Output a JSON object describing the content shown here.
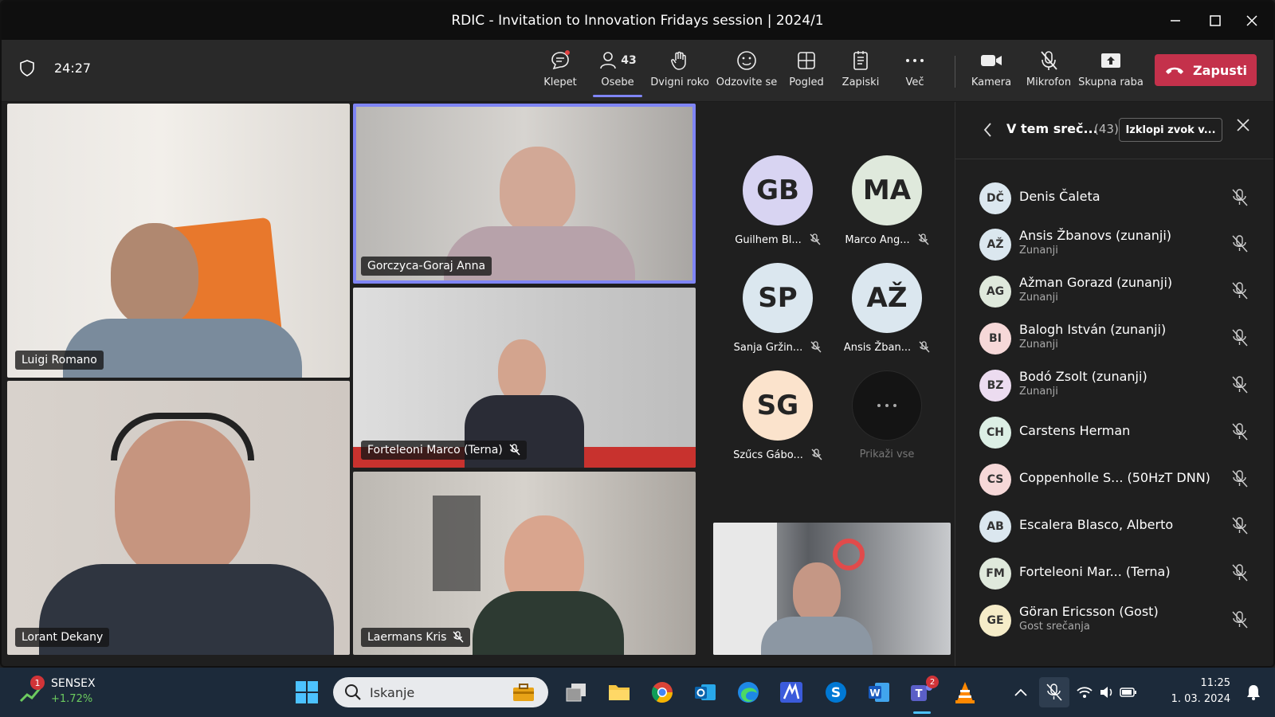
{
  "window": {
    "title": "RDIC - Invitation to Innovation Fridays session | 2024/1"
  },
  "toolbar": {
    "timer": "24:27",
    "chat_label": "Klepet",
    "people_label": "Osebe",
    "people_count": "43",
    "raise_label": "Dvigni roko",
    "react_label": "Odzovite se",
    "view_label": "Pogled",
    "notes_label": "Zapiski",
    "more_label": "Več",
    "camera_label": "Kamera",
    "mic_label": "Mikrofon",
    "share_label": "Skupna raba",
    "leave_label": "Zapusti"
  },
  "tiles": {
    "luigi": "Luigi Romano",
    "anna": "Gorczyca-Goraj Anna",
    "marco": "Forteleoni Marco (Terna)",
    "lorant": "Lorant Dekany",
    "kris": "Laermans Kris"
  },
  "avatars": [
    {
      "initials": "GB",
      "name": "Guilhem Bl...",
      "color": "#d8d4f2"
    },
    {
      "initials": "MA",
      "name": "Marco Ang...",
      "color": "#dfe9dc"
    },
    {
      "initials": "SP",
      "name": "Sanja Gržin...",
      "color": "#dbe7ef"
    },
    {
      "initials": "AŽ",
      "name": "Ansis Žban...",
      "color": "#dbe7ef"
    },
    {
      "initials": "SG",
      "name": "Szűcs Gábo...",
      "color": "#fbe3cc"
    },
    {
      "initials": "",
      "name": "Prikaži vse",
      "color": "#141414"
    }
  ],
  "panel": {
    "title": "V tem sreč...",
    "count": "(43)",
    "mute_all": "Izklopi zvok v...",
    "participants": [
      {
        "initials": "DČ",
        "name": "Denis Čaleta",
        "sub": "",
        "color": "#dbe7ef"
      },
      {
        "initials": "AŽ",
        "name": "Ansis Žbanovs (zunanji)",
        "sub": "Zunanji",
        "color": "#dbe7ef"
      },
      {
        "initials": "AG",
        "name": "Ažman Gorazd (zunanji)",
        "sub": "Zunanji",
        "color": "#dfe9dc"
      },
      {
        "initials": "BI",
        "name": "Balogh István (zunanji)",
        "sub": "Zunanji",
        "color": "#f6d8d8"
      },
      {
        "initials": "BZ",
        "name": "Bodó Zsolt (zunanji)",
        "sub": "Zunanji",
        "color": "#ecdcf0"
      },
      {
        "initials": "CH",
        "name": "Carstens Herman",
        "sub": "",
        "color": "#dcefe5"
      },
      {
        "initials": "CS",
        "name": "Coppenholle S...  (50HzT DNN)",
        "sub": "",
        "color": "#f6d8d8"
      },
      {
        "initials": "AB",
        "name": "Escalera Blasco, Alberto",
        "sub": "",
        "color": "#dbe7ef"
      },
      {
        "initials": "FM",
        "name": "Forteleoni Mar...  (Terna)",
        "sub": "",
        "color": "#dfe9dc"
      },
      {
        "initials": "GE",
        "name": "Göran Ericsson (Gost)",
        "sub": "Gost srečanja",
        "color": "#f5ecc8"
      }
    ]
  },
  "taskbar": {
    "stock_name": "SENSEX",
    "stock_change": "+1.72%",
    "notif_count": "1",
    "search_placeholder": "Iskanje",
    "teams_badge": "2",
    "time": "11:25",
    "date": "1. 03. 2024"
  },
  "colors": {
    "accent": "#7f85f5",
    "leave": "#c4314b",
    "positive": "#6ccb5f"
  }
}
